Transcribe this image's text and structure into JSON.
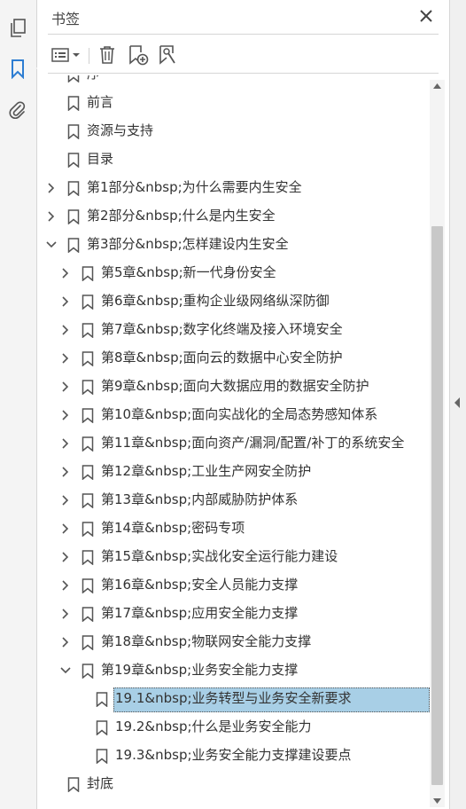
{
  "panel": {
    "title": "书签"
  },
  "bookmarks": [
    {
      "label": "序",
      "level": 0,
      "expand": "none"
    },
    {
      "label": "前言",
      "level": 0,
      "expand": "none"
    },
    {
      "label": "资源与支持",
      "level": 0,
      "expand": "none"
    },
    {
      "label": "目录",
      "level": 0,
      "expand": "none"
    },
    {
      "label": "第1部分&nbsp;为什么需要内生安全",
      "level": 0,
      "expand": "collapsed"
    },
    {
      "label": "第2部分&nbsp;什么是内生安全",
      "level": 0,
      "expand": "collapsed"
    },
    {
      "label": "第3部分&nbsp;怎样建设内生安全",
      "level": 0,
      "expand": "expanded"
    },
    {
      "label": "第5章&nbsp;新一代身份安全",
      "level": 1,
      "expand": "collapsed"
    },
    {
      "label": "第6章&nbsp;重构企业级网络纵深防御",
      "level": 1,
      "expand": "collapsed"
    },
    {
      "label": "第7章&nbsp;数字化终端及接入环境安全",
      "level": 1,
      "expand": "collapsed"
    },
    {
      "label": "第8章&nbsp;面向云的数据中心安全防护",
      "level": 1,
      "expand": "collapsed"
    },
    {
      "label": "第9章&nbsp;面向大数据应用的数据安全防护",
      "level": 1,
      "expand": "collapsed"
    },
    {
      "label": "第10章&nbsp;面向实战化的全局态势感知体系",
      "level": 1,
      "expand": "collapsed"
    },
    {
      "label": "第11章&nbsp;面向资产/漏洞/配置/补丁的系统安全",
      "level": 1,
      "expand": "collapsed"
    },
    {
      "label": "第12章&nbsp;工业生产网安全防护",
      "level": 1,
      "expand": "collapsed"
    },
    {
      "label": "第13章&nbsp;内部威胁防护体系",
      "level": 1,
      "expand": "collapsed"
    },
    {
      "label": "第14章&nbsp;密码专项",
      "level": 1,
      "expand": "collapsed"
    },
    {
      "label": "第15章&nbsp;实战化安全运行能力建设",
      "level": 1,
      "expand": "collapsed"
    },
    {
      "label": "第16章&nbsp;安全人员能力支撑",
      "level": 1,
      "expand": "collapsed"
    },
    {
      "label": "第17章&nbsp;应用安全能力支撑",
      "level": 1,
      "expand": "collapsed"
    },
    {
      "label": "第18章&nbsp;物联网安全能力支撑",
      "level": 1,
      "expand": "collapsed"
    },
    {
      "label": "第19章&nbsp;业务安全能力支撑",
      "level": 1,
      "expand": "expanded"
    },
    {
      "label": "19.1&nbsp;业务转型与业务安全新要求",
      "level": 2,
      "expand": "none",
      "selected": true
    },
    {
      "label": "19.2&nbsp;什么是业务安全能力",
      "level": 2,
      "expand": "none"
    },
    {
      "label": "19.3&nbsp;业务安全能力支撑建设要点",
      "level": 2,
      "expand": "none"
    },
    {
      "label": "封底",
      "level": 0,
      "expand": "none"
    }
  ],
  "colors": {
    "selection": "#a8cfe6",
    "icon": "#555555",
    "accent_blue": "#2d7dd2"
  }
}
